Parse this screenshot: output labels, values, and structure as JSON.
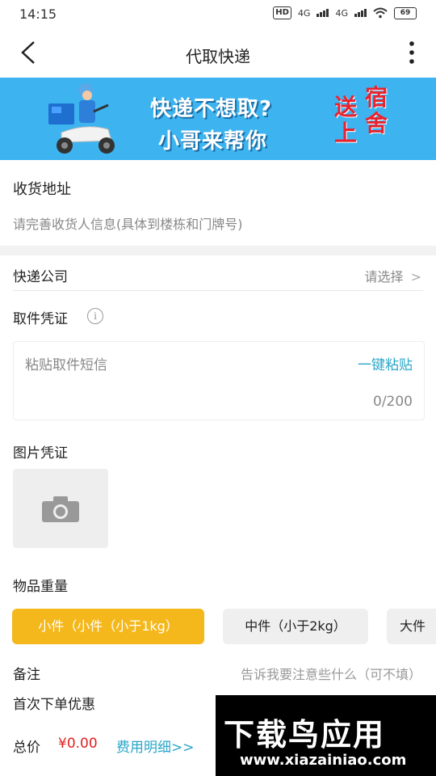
{
  "status": {
    "time": "14:15",
    "hd": "HD",
    "net1": "4G",
    "net2": "4G",
    "battery": "69"
  },
  "nav": {
    "title": "代取快递"
  },
  "banner": {
    "line1": "快递不想取?",
    "line2": "小哥来帮你",
    "red1": "宿",
    "red2": "送",
    "red3": "舍",
    "red4": "上"
  },
  "address": {
    "label": "收货地址",
    "hint": "请完善收货人信息(具体到楼栋和门牌号)"
  },
  "courier": {
    "label": "快递公司",
    "value": "请选择",
    "chevron": ">"
  },
  "voucher": {
    "label": "取件凭证",
    "info": "i",
    "placeholder": "粘贴取件短信",
    "paste": "一键粘贴",
    "count": "0/200"
  },
  "image_voucher": {
    "label": "图片凭证",
    "icon": "camera-icon"
  },
  "weight": {
    "label": "物品重量",
    "options": [
      "小件（小件（小于1kg）",
      "中件（小于2kg）",
      "大件"
    ],
    "selected": 0,
    "selected_color": "#f5b81c"
  },
  "remark": {
    "label": "备注",
    "placeholder": "告诉我要注意些什么（可不填）"
  },
  "discount": {
    "label": "首次下单优惠"
  },
  "total": {
    "label": "总价",
    "value": "¥0.00",
    "detail": "费用明细>>"
  },
  "watermark": {
    "text": "下载鸟应用",
    "url": "www.xiazainiao.com"
  },
  "colors": {
    "accent": "#2aa7c9",
    "banner": "#3db4f0",
    "price": "#e02020"
  }
}
